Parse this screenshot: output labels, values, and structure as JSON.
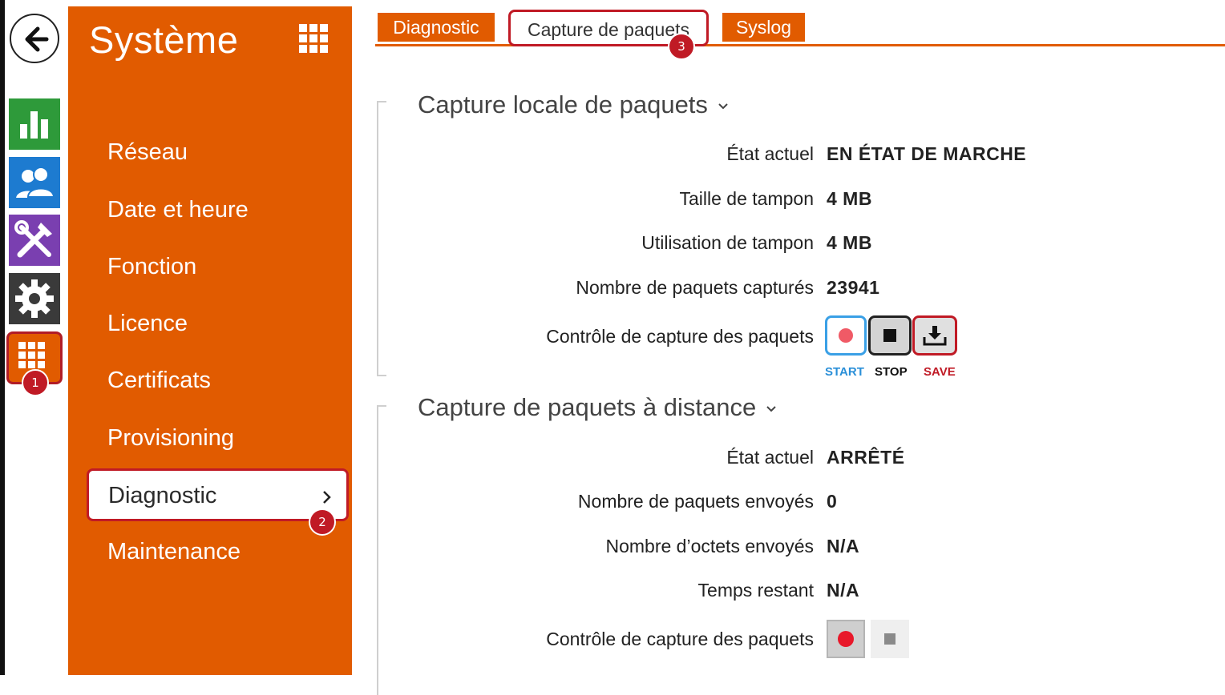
{
  "sidebar": {
    "title": "Système",
    "items": [
      {
        "label": "Réseau"
      },
      {
        "label": "Date et heure"
      },
      {
        "label": "Fonction"
      },
      {
        "label": "Licence"
      },
      {
        "label": "Certificats"
      },
      {
        "label": "Provisioning"
      },
      {
        "label": "Diagnostic",
        "selected": true
      },
      {
        "label": "Maintenance"
      }
    ]
  },
  "rail": {
    "icons": [
      "back-arrow-icon",
      "status-chart-icon",
      "users-icon",
      "services-tools-icon",
      "hardware-gear-icon",
      "system-grid-icon"
    ],
    "colors": {
      "status": "#2e9a3a",
      "users": "#1d7bd0",
      "services": "#7a3fb0",
      "hardware": "#3a3a3a",
      "system": "#e15b00"
    }
  },
  "tabs": [
    {
      "label": "Diagnostic"
    },
    {
      "label": "Capture de paquets",
      "active": true
    },
    {
      "label": "Syslog"
    }
  ],
  "badges": {
    "one": "1",
    "two": "2",
    "three": "3"
  },
  "local_capture": {
    "title": "Capture locale de paquets",
    "rows": [
      {
        "label": "État actuel",
        "value": "EN ÉTAT DE MARCHE"
      },
      {
        "label": "Taille de tampon",
        "value": "4 MB"
      },
      {
        "label": "Utilisation de tampon",
        "value": "4 MB"
      },
      {
        "label": "Nombre de paquets capturés",
        "value": "23941"
      }
    ],
    "control_label": "Contrôle de capture des paquets",
    "buttons": {
      "start": "START",
      "stop": "STOP",
      "save": "SAVE"
    }
  },
  "remote_capture": {
    "title": "Capture de paquets à distance",
    "rows": [
      {
        "label": "État actuel",
        "value": "ARRÊTÉ"
      },
      {
        "label": "Nombre de paquets envoyés",
        "value": "0"
      },
      {
        "label": "Nombre d’octets envoyés",
        "value": "N/A"
      },
      {
        "label": "Temps restant",
        "value": "N/A"
      }
    ],
    "control_label": "Contrôle de capture des paquets"
  },
  "colors": {
    "accent": "#e15b00",
    "highlight": "#c01a25",
    "start_blue": "#3aa0e6",
    "record_red": "#e8182a"
  }
}
